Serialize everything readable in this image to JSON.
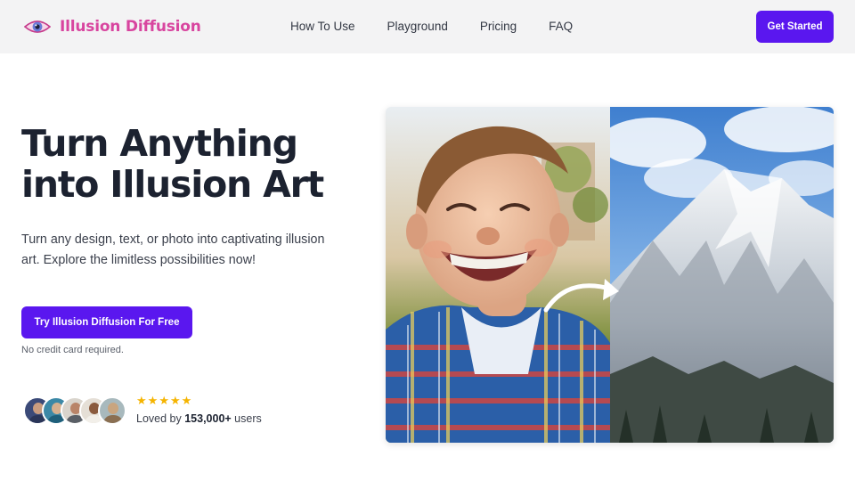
{
  "brand": {
    "name": "Illusion Diffusion",
    "color": "#d8459f"
  },
  "nav": {
    "links": [
      "How To Use",
      "Playground",
      "Pricing",
      "FAQ"
    ],
    "cta_label": "Get Started"
  },
  "hero": {
    "headline_line1": "Turn Anything",
    "headline_line2": "into Illusion Art",
    "subtext": "Turn any design, text, or photo into captivating illusion art. Explore the limitless possibilities now!",
    "cta_label": "Try Illusion Diffusion For Free",
    "note": "No credit card required.",
    "rating": {
      "stars": 5,
      "star_char": "★",
      "loved_prefix": "Loved by ",
      "loved_count": "153,000+",
      "loved_suffix": " users"
    },
    "image": {
      "left": "smiling child in plaid shirt",
      "right": "snowy mountain peak",
      "arrow": "curved-arrow-icon"
    }
  },
  "colors": {
    "accent": "#5a17ef",
    "nav_bg": "#f3f3f4",
    "star": "#f5b400"
  }
}
